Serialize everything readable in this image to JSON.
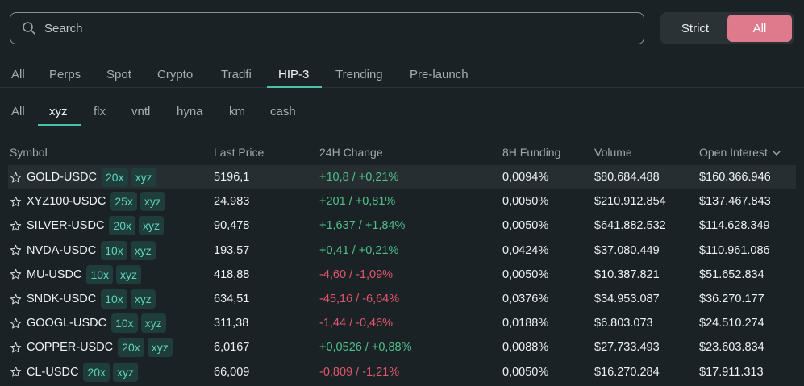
{
  "search": {
    "placeholder": "Search"
  },
  "toggle": {
    "strict": "Strict",
    "all": "All"
  },
  "market_tabs": [
    "All",
    "Perps",
    "Spot",
    "Crypto",
    "Tradfi",
    "HIP-3",
    "Trending",
    "Pre-launch"
  ],
  "market_tab_active": "HIP-3",
  "dex_tabs": [
    "All",
    "xyz",
    "flx",
    "vntl",
    "hyna",
    "km",
    "cash"
  ],
  "dex_tab_active": "xyz",
  "columns": [
    "Symbol",
    "Last Price",
    "24H Change",
    "8H Funding",
    "Volume",
    "Open Interest"
  ],
  "sorted_column": "Open Interest",
  "colors": {
    "accent": "#4fbfa9",
    "positive": "#4fbf8a",
    "negative": "#e0566b",
    "toggle_active": "#df7a8d"
  },
  "rows": [
    {
      "symbol": "GOLD-USDC",
      "leverage": "20x",
      "dex": "xyz",
      "last_price": "5196,1",
      "change": "+10,8 / +0,21%",
      "direction": "up",
      "funding": "0,0094%",
      "volume": "$80.684.488",
      "open_interest": "$160.366.946"
    },
    {
      "symbol": "XYZ100-USDC",
      "leverage": "25x",
      "dex": "xyz",
      "last_price": "24.983",
      "change": "+201 / +0,81%",
      "direction": "up",
      "funding": "0,0050%",
      "volume": "$210.912.854",
      "open_interest": "$137.467.843"
    },
    {
      "symbol": "SILVER-USDC",
      "leverage": "20x",
      "dex": "xyz",
      "last_price": "90,478",
      "change": "+1,637 / +1,84%",
      "direction": "up",
      "funding": "0,0050%",
      "volume": "$641.882.532",
      "open_interest": "$114.628.349"
    },
    {
      "symbol": "NVDA-USDC",
      "leverage": "10x",
      "dex": "xyz",
      "last_price": "193,57",
      "change": "+0,41 / +0,21%",
      "direction": "up",
      "funding": "0,0424%",
      "volume": "$37.080.449",
      "open_interest": "$110.961.086"
    },
    {
      "symbol": "MU-USDC",
      "leverage": "10x",
      "dex": "xyz",
      "last_price": "418,88",
      "change": "-4,60 / -1,09%",
      "direction": "down",
      "funding": "0,0050%",
      "volume": "$10.387.821",
      "open_interest": "$51.652.834"
    },
    {
      "symbol": "SNDK-USDC",
      "leverage": "10x",
      "dex": "xyz",
      "last_price": "634,51",
      "change": "-45,16 / -6,64%",
      "direction": "down",
      "funding": "0,0376%",
      "volume": "$34.953.087",
      "open_interest": "$36.270.177"
    },
    {
      "symbol": "GOOGL-USDC",
      "leverage": "10x",
      "dex": "xyz",
      "last_price": "311,38",
      "change": "-1,44 / -0,46%",
      "direction": "down",
      "funding": "0,0188%",
      "volume": "$6.803.073",
      "open_interest": "$24.510.274"
    },
    {
      "symbol": "COPPER-USDC",
      "leverage": "20x",
      "dex": "xyz",
      "last_price": "6,0167",
      "change": "+0,0526 / +0,88%",
      "direction": "up",
      "funding": "0,0088%",
      "volume": "$27.733.493",
      "open_interest": "$23.603.834"
    },
    {
      "symbol": "CL-USDC",
      "leverage": "20x",
      "dex": "xyz",
      "last_price": "66,009",
      "change": "-0,809 / -1,21%",
      "direction": "down",
      "funding": "0,0050%",
      "volume": "$16.270.284",
      "open_interest": "$17.911.313"
    }
  ]
}
